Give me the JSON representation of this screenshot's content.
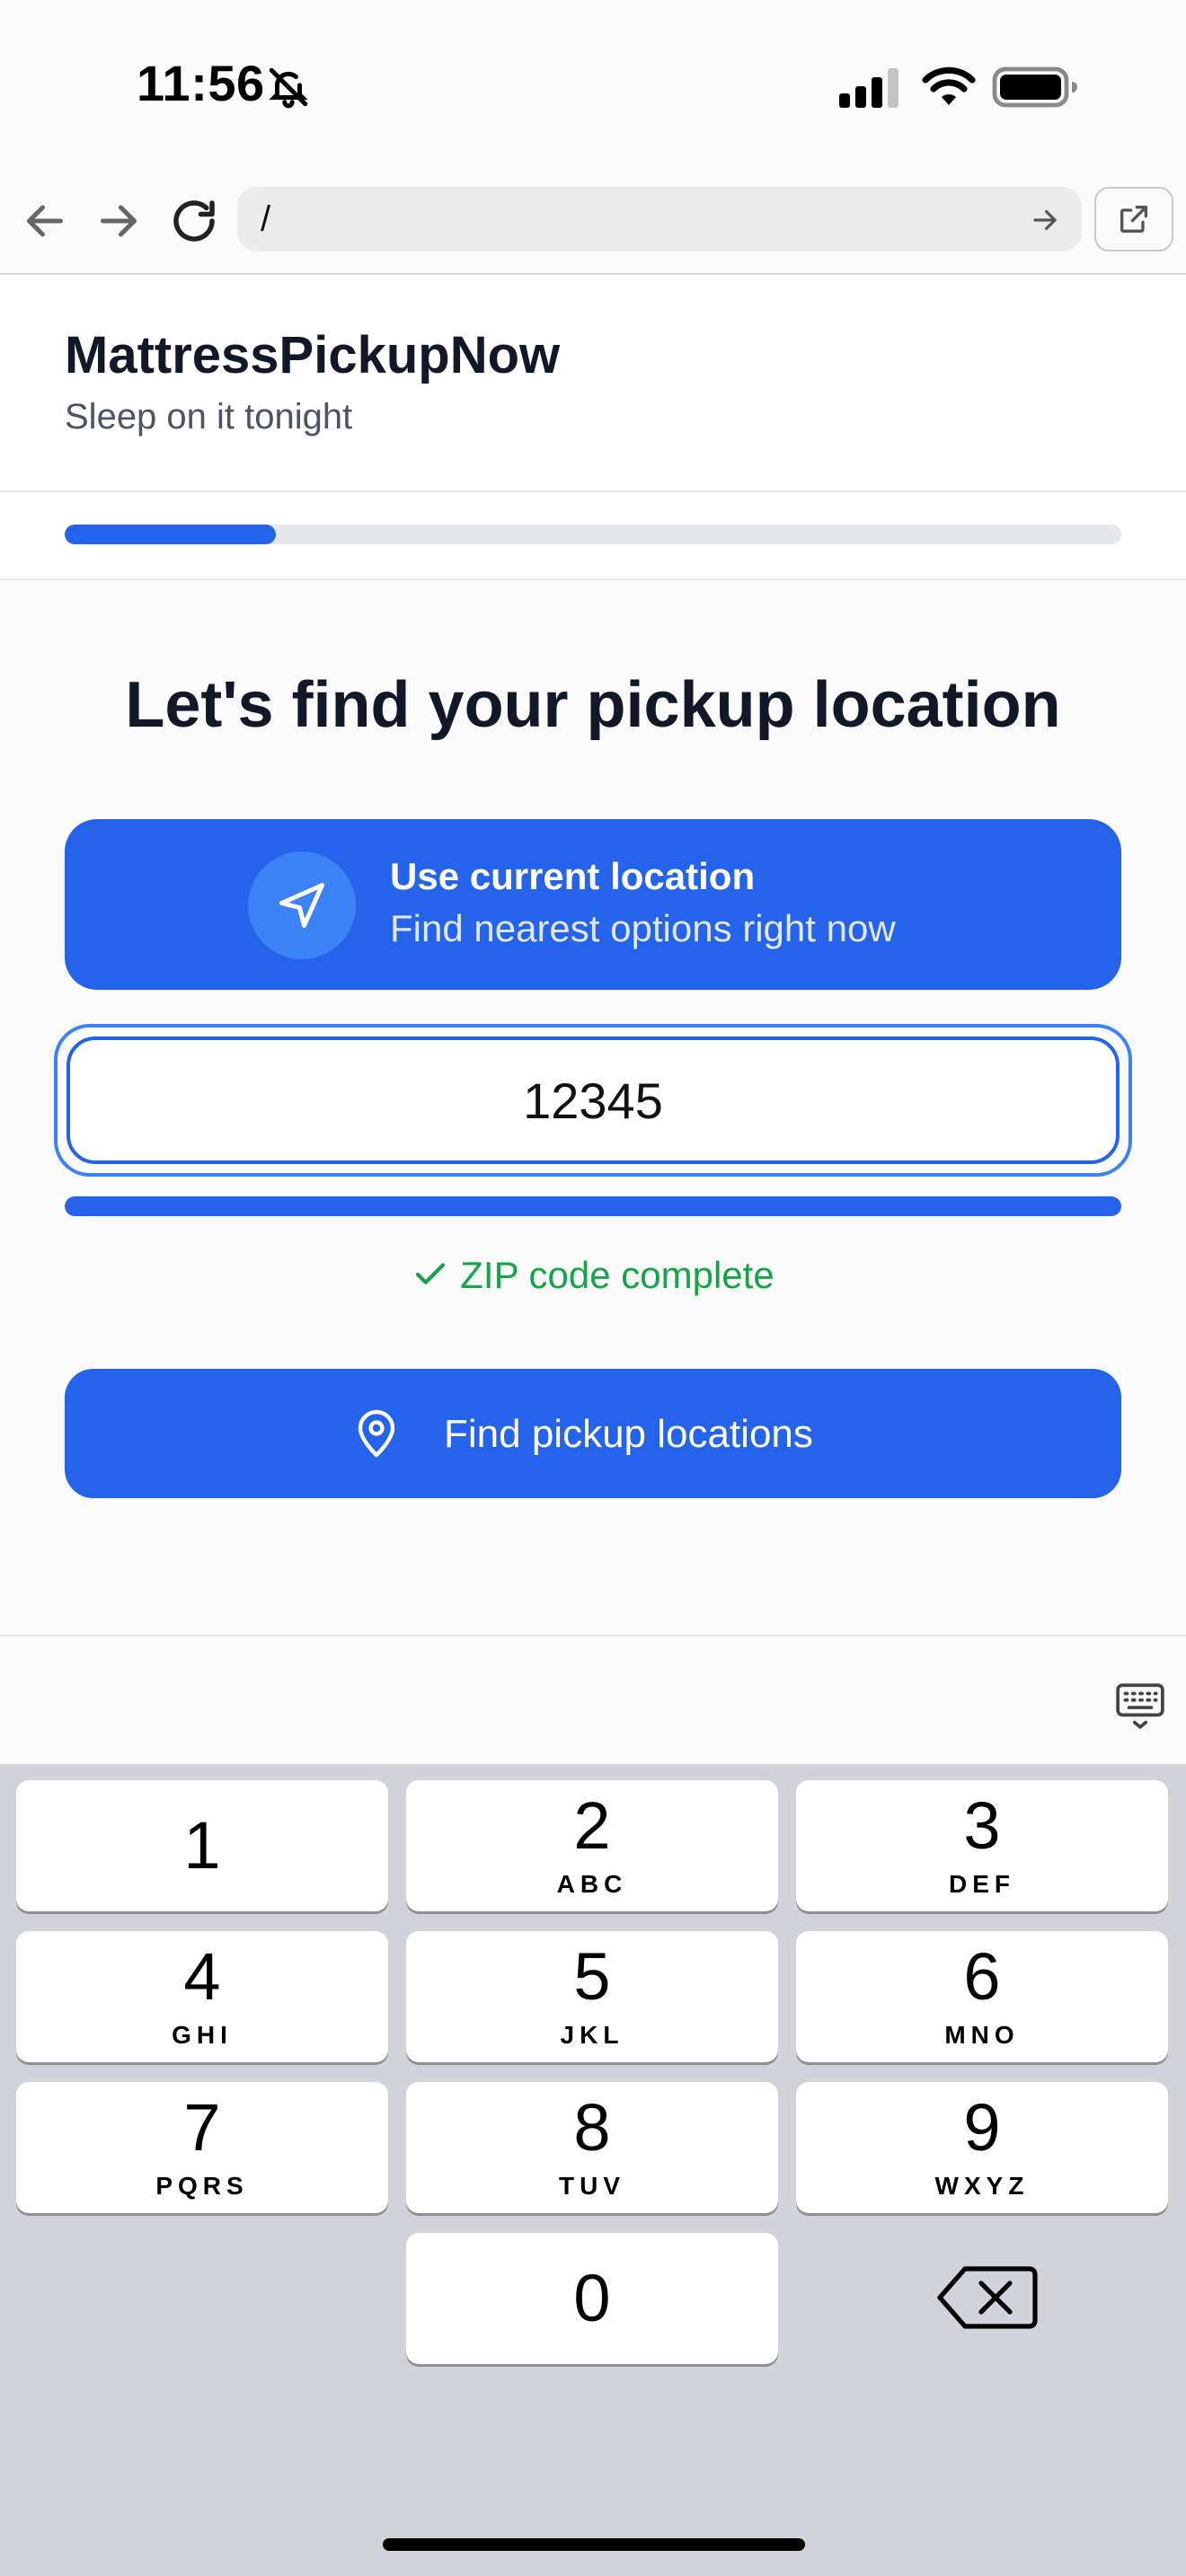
{
  "status_bar": {
    "time": "11:56"
  },
  "browser": {
    "url": "/"
  },
  "header": {
    "brand": "MattressPickupNow",
    "tagline": "Sleep on it tonight"
  },
  "progress": {
    "step_fraction": 0.2
  },
  "main": {
    "heading": "Let's find your pickup location",
    "use_location": {
      "title": "Use current location",
      "subtitle": "Find nearest options right now"
    },
    "zip_input": {
      "value": "12345",
      "progress_fraction": 1.0
    },
    "zip_status": "ZIP code complete",
    "find_button_label": "Find pickup locations"
  },
  "keypad": {
    "keys": [
      {
        "num": "1",
        "letters": ""
      },
      {
        "num": "2",
        "letters": "ABC"
      },
      {
        "num": "3",
        "letters": "DEF"
      },
      {
        "num": "4",
        "letters": "GHI"
      },
      {
        "num": "5",
        "letters": "JKL"
      },
      {
        "num": "6",
        "letters": "MNO"
      },
      {
        "num": "7",
        "letters": "PQRS"
      },
      {
        "num": "8",
        "letters": "TUV"
      },
      {
        "num": "9",
        "letters": "WXYZ"
      },
      {
        "num": "0",
        "letters": ""
      }
    ]
  },
  "colors": {
    "accent": "#2563eb",
    "success": "#16a34a"
  }
}
